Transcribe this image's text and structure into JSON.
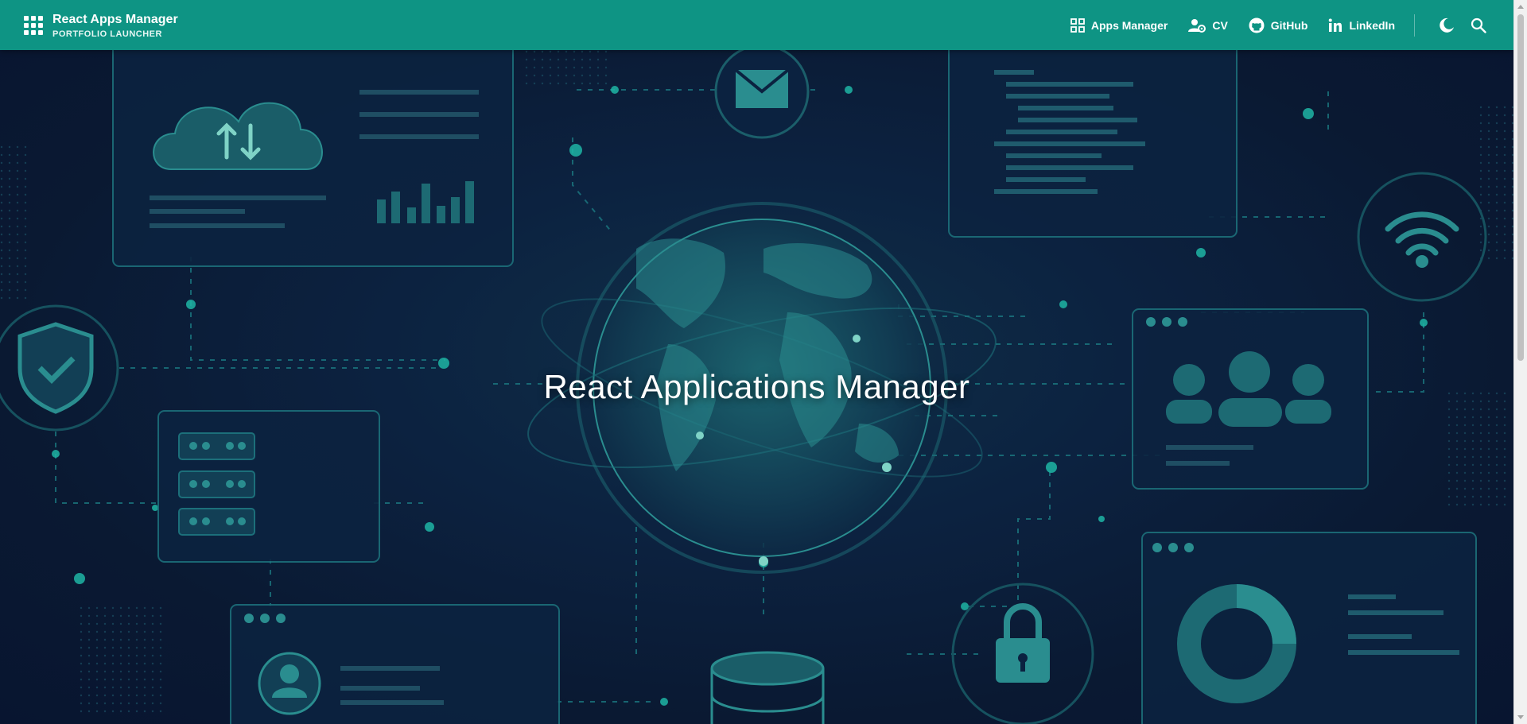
{
  "header": {
    "title": "React Apps Manager",
    "subtitle": "PORTFOLIO LAUNCHER",
    "menu_icon": "apps-grid-icon",
    "nav": [
      {
        "label": "Apps Manager",
        "icon": "apps-dashboard-icon"
      },
      {
        "label": "CV",
        "icon": "user-gear-icon"
      },
      {
        "label": "GitHub",
        "icon": "github-icon"
      },
      {
        "label": "LinkedIn",
        "icon": "linkedin-icon"
      }
    ],
    "theme_toggle_icon": "moon-icon",
    "search_icon": "search-icon"
  },
  "hero": {
    "title": "React Applications Manager"
  },
  "colors": {
    "header": "#0e9484",
    "background": "#0b1a33",
    "accent": "#1fb5a4"
  }
}
